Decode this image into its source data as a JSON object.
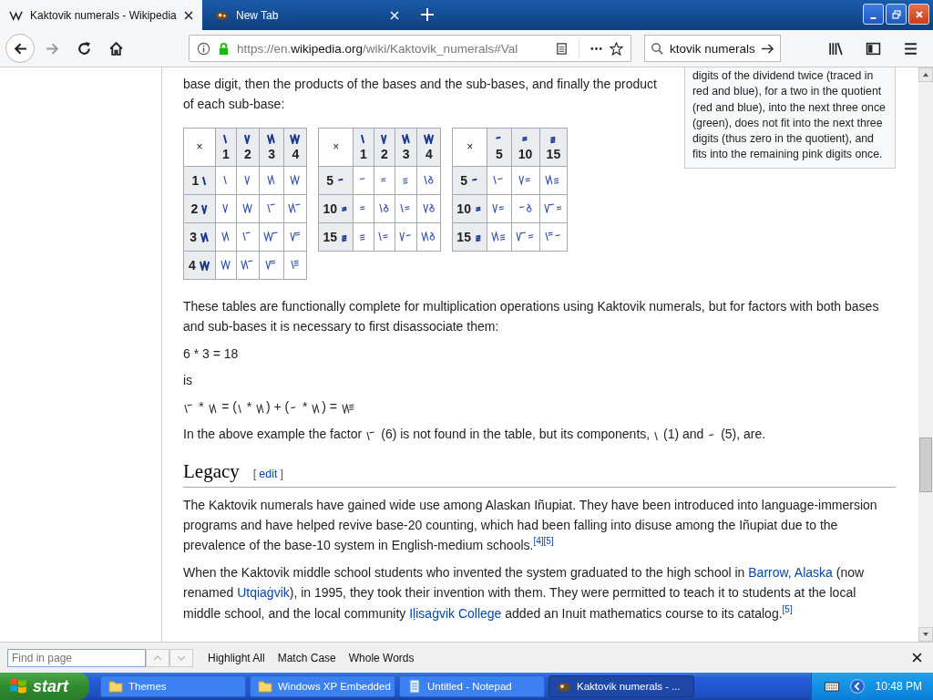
{
  "browser": {
    "tabs": [
      {
        "title": "Kaktovik numerals - Wikipedia",
        "selected": true,
        "kind": "wiki"
      },
      {
        "title": "New Tab",
        "selected": false,
        "kind": "newtab"
      }
    ],
    "url": {
      "scheme": "https://en.",
      "domain": "wikipedia.org",
      "path": "/wiki/Kaktovik_numerals#Val"
    },
    "search": {
      "value": "ktovik numerals"
    }
  },
  "article": {
    "intro": "base digit, then the products of the bases and the sub-bases, and finally the product of each sub-base:",
    "aside": "digits of the dividend twice (traced in red and blue), for a two in the quotient (red and blue), into the next three once (green), does not fit into the next three digits (thus zero in the quotient), and fits into the remaining pink digits once.",
    "tables": [
      {
        "corner": "×",
        "columns": [
          {
            "digits": [
              {
                "kind": "d1"
              }
            ],
            "label": "1"
          },
          {
            "digits": [
              {
                "kind": "d2"
              }
            ],
            "label": "2"
          },
          {
            "digits": [
              {
                "kind": "d3"
              }
            ],
            "label": "3"
          },
          {
            "digits": [
              {
                "kind": "d4"
              }
            ],
            "label": "4"
          }
        ],
        "rows": [
          {
            "label": "1",
            "digits": [
              {
                "kind": "d1"
              }
            ],
            "cells": [
              [
                {
                  "kind": "d1"
                }
              ],
              [
                {
                  "kind": "d2"
                }
              ],
              [
                {
                  "kind": "d3"
                }
              ],
              [
                {
                  "kind": "d4"
                }
              ]
            ]
          },
          {
            "label": "2",
            "digits": [
              {
                "kind": "d2"
              }
            ],
            "cells": [
              [
                {
                  "kind": "d2"
                }
              ],
              [
                {
                  "kind": "d4"
                }
              ],
              [
                {
                  "kind": "d6"
                }
              ],
              [
                {
                  "kind": "d8"
                }
              ]
            ]
          },
          {
            "label": "3",
            "digits": [
              {
                "kind": "d3"
              }
            ],
            "cells": [
              [
                {
                  "kind": "d3"
                }
              ],
              [
                {
                  "kind": "d6"
                }
              ],
              [
                {
                  "kind": "d9"
                }
              ],
              [
                {
                  "kind": "d12"
                }
              ]
            ]
          },
          {
            "label": "4",
            "digits": [
              {
                "kind": "d4"
              }
            ],
            "cells": [
              [
                {
                  "kind": "d4"
                }
              ],
              [
                {
                  "kind": "d8"
                }
              ],
              [
                {
                  "kind": "d12"
                }
              ],
              [
                {
                  "kind": "d16"
                }
              ]
            ]
          }
        ]
      },
      {
        "corner": "×",
        "columns": [
          {
            "digits": [
              {
                "kind": "d1"
              }
            ],
            "label": "1"
          },
          {
            "digits": [
              {
                "kind": "d2"
              }
            ],
            "label": "2"
          },
          {
            "digits": [
              {
                "kind": "d3"
              }
            ],
            "label": "3"
          },
          {
            "digits": [
              {
                "kind": "d4"
              }
            ],
            "label": "4"
          }
        ],
        "rows": [
          {
            "label": "5",
            "digits": [
              {
                "kind": "d5"
              }
            ],
            "cells": [
              [
                {
                  "kind": "d5"
                }
              ],
              [
                {
                  "kind": "d10"
                }
              ],
              [
                {
                  "kind": "d15"
                }
              ],
              [
                {
                  "kind": "d1"
                },
                {
                  "kind": "d0"
                }
              ]
            ]
          },
          {
            "label": "10",
            "digits": [
              {
                "kind": "d10"
              }
            ],
            "cells": [
              [
                {
                  "kind": "d10"
                }
              ],
              [
                {
                  "kind": "d1"
                },
                {
                  "kind": "d0"
                }
              ],
              [
                {
                  "kind": "d1"
                },
                {
                  "kind": "d10"
                }
              ],
              [
                {
                  "kind": "d2"
                },
                {
                  "kind": "d0"
                }
              ]
            ]
          },
          {
            "label": "15",
            "digits": [
              {
                "kind": "d15"
              }
            ],
            "cells": [
              [
                {
                  "kind": "d15"
                }
              ],
              [
                {
                  "kind": "d1"
                },
                {
                  "kind": "d10"
                }
              ],
              [
                {
                  "kind": "d2"
                },
                {
                  "kind": "d5"
                }
              ],
              [
                {
                  "kind": "d3"
                },
                {
                  "kind": "d0"
                }
              ]
            ]
          }
        ]
      },
      {
        "corner": "×",
        "columns": [
          {
            "digits": [
              {
                "kind": "d5"
              }
            ],
            "label": "5"
          },
          {
            "digits": [
              {
                "kind": "d10"
              }
            ],
            "label": "10"
          },
          {
            "digits": [
              {
                "kind": "d15"
              }
            ],
            "label": "15"
          }
        ],
        "rows": [
          {
            "label": "5",
            "digits": [
              {
                "kind": "d5"
              }
            ],
            "cells": [
              [
                {
                  "kind": "d1"
                },
                {
                  "kind": "d5"
                }
              ],
              [
                {
                  "kind": "d2"
                },
                {
                  "kind": "d10"
                }
              ],
              [
                {
                  "kind": "d3"
                },
                {
                  "kind": "d15"
                }
              ]
            ]
          },
          {
            "label": "10",
            "digits": [
              {
                "kind": "d10"
              }
            ],
            "cells": [
              [
                {
                  "kind": "d2"
                },
                {
                  "kind": "d10"
                }
              ],
              [
                {
                  "kind": "d5"
                },
                {
                  "kind": "d0"
                }
              ],
              [
                {
                  "kind": "d7"
                },
                {
                  "kind": "d10"
                }
              ]
            ]
          },
          {
            "label": "15",
            "digits": [
              {
                "kind": "d15"
              }
            ],
            "cells": [
              [
                {
                  "kind": "d3"
                },
                {
                  "kind": "d15"
                }
              ],
              [
                {
                  "kind": "d7"
                },
                {
                  "kind": "d10"
                }
              ],
              [
                {
                  "kind": "d11"
                },
                {
                  "kind": "d5"
                }
              ]
            ]
          }
        ]
      }
    ],
    "body1": "These tables are functionally complete for multiplication operations using Kaktovik numerals, but for factors with both bases and sub-bases it is necessary to first disassociate them:",
    "example": "6 * 3 = 18",
    "is": "is",
    "formula": [
      {
        "kind": "glyph",
        "digits": [
          {
            "kind": "d6"
          }
        ]
      },
      {
        "kind": "text",
        "text": " * "
      },
      {
        "kind": "glyph",
        "digits": [
          {
            "kind": "d3"
          }
        ]
      },
      {
        "kind": "text",
        "text": " = ("
      },
      {
        "kind": "glyph",
        "digits": [
          {
            "kind": "d1"
          }
        ]
      },
      {
        "kind": "text",
        "text": " * "
      },
      {
        "kind": "glyph",
        "digits": [
          {
            "kind": "d3"
          }
        ]
      },
      {
        "kind": "text",
        "text": ") + ("
      },
      {
        "kind": "glyph",
        "digits": [
          {
            "kind": "d5"
          }
        ]
      },
      {
        "kind": "text",
        "text": " * "
      },
      {
        "kind": "glyph",
        "digits": [
          {
            "kind": "d3"
          }
        ]
      },
      {
        "kind": "text",
        "text": ") = "
      },
      {
        "kind": "glyph",
        "digits": [
          {
            "kind": "d18"
          }
        ]
      }
    ],
    "note": [
      {
        "kind": "text",
        "text": "In the above example the factor "
      },
      {
        "kind": "glyph",
        "digits": [
          {
            "kind": "d6"
          }
        ]
      },
      {
        "kind": "text",
        "text": " (6) is not found in the table, but its components, "
      },
      {
        "kind": "glyph",
        "digits": [
          {
            "kind": "d1"
          }
        ]
      },
      {
        "kind": "text",
        "text": " (1) and "
      },
      {
        "kind": "glyph",
        "digits": [
          {
            "kind": "d5"
          }
        ]
      },
      {
        "kind": "text",
        "text": " (5), are."
      }
    ],
    "section": {
      "heading": "Legacy",
      "edit_open": "[",
      "edit": "edit",
      "edit_close": "]"
    },
    "paragraphs": [
      [
        {
          "kind": "text",
          "text": "The Kaktovik numerals have gained wide use among Alaskan Iñupiat. They have been introduced into language-immersion programs and have helped revive base-20 counting, which had been falling into disuse among the Iñupiat due to the prevalence of the base-10 system in English-medium schools."
        },
        {
          "kind": "ref",
          "text": "[4]"
        },
        {
          "kind": "ref",
          "text": "[5]"
        }
      ],
      [
        {
          "kind": "text",
          "text": "When the Kaktovik middle school students who invented the system graduated to the high school in "
        },
        {
          "kind": "link",
          "text": "Barrow, Alaska"
        },
        {
          "kind": "text",
          "text": " (now renamed "
        },
        {
          "kind": "link",
          "text": "Utqiaġvik"
        },
        {
          "kind": "text",
          "text": "), in 1995, they took their invention with them. They were permitted to teach it to students at the local middle school, and the local community "
        },
        {
          "kind": "link",
          "text": "Iḷisaġvik College"
        },
        {
          "kind": "text",
          "text": " added an Inuit mathematics course to its catalog."
        },
        {
          "kind": "ref",
          "text": "[5]"
        }
      ]
    ]
  },
  "find_bar": {
    "placeholder": "Find in page",
    "options": [
      "Highlight All",
      "Match Case",
      "Whole Words"
    ]
  },
  "taskbar": {
    "start": "start",
    "items": [
      {
        "label": "Themes",
        "kind": "folder",
        "selected": false
      },
      {
        "label": "Windows XP Embedded",
        "kind": "folder",
        "selected": false
      },
      {
        "label": "Untitled - Notepad",
        "kind": "notepad",
        "selected": false
      },
      {
        "label": "Kaktovik numerals - ...",
        "kind": "browser",
        "selected": true
      }
    ],
    "clock": "10:48 PM"
  }
}
